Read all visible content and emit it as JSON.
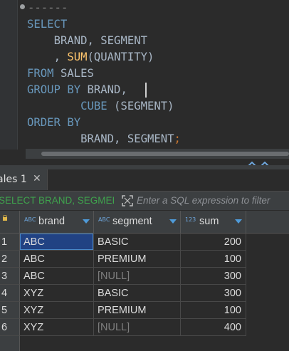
{
  "editor": {
    "comment": "------",
    "lines": [
      {
        "kw": "SELECT"
      },
      {
        "indent": "    ",
        "id": "BRAND, SEGMENT"
      },
      {
        "indent": "    ",
        "pre": ", ",
        "fn": "SUM",
        "post": "(QUANTITY)"
      },
      {
        "kw": "FROM",
        "post": " SALES"
      },
      {
        "kw": "GROUP BY",
        "post": " BRAND,"
      },
      {
        "indent": "        ",
        "kw": "CUBE",
        "post": " (SEGMENT)"
      },
      {
        "kw": "ORDER BY"
      },
      {
        "indent": "        ",
        "id": "BRAND, SEGMENT",
        "semi": ";"
      }
    ],
    "colors": {
      "keyword": "#6897bb",
      "function": "#ffc66d",
      "identifier": "#a9b7c6",
      "semicolon": "#cc7832"
    }
  },
  "results_tab": {
    "label": "ales 1",
    "close_icon": "close-icon"
  },
  "filter": {
    "query_text": "SELECT BRAND, SEGMEI",
    "expand_icon": "expand-icon",
    "placeholder": "Enter a SQL expression to filter"
  },
  "grid": {
    "columns": [
      {
        "type": "ABC",
        "label": "brand"
      },
      {
        "type": "ABC",
        "label": "segment"
      },
      {
        "type": "123",
        "label": "sum"
      }
    ],
    "rows": [
      {
        "num": "1",
        "brand": "ABC",
        "segment": "BASIC",
        "sum": "200",
        "segment_null": false
      },
      {
        "num": "2",
        "brand": "ABC",
        "segment": "PREMIUM",
        "sum": "100",
        "segment_null": false
      },
      {
        "num": "3",
        "brand": "ABC",
        "segment": "[NULL]",
        "sum": "300",
        "segment_null": true
      },
      {
        "num": "4",
        "brand": "XYZ",
        "segment": "BASIC",
        "sum": "300",
        "segment_null": false
      },
      {
        "num": "5",
        "brand": "XYZ",
        "segment": "PREMIUM",
        "sum": "100",
        "segment_null": false
      },
      {
        "num": "6",
        "brand": "XYZ",
        "segment": "[NULL]",
        "sum": "400",
        "segment_null": true
      }
    ],
    "selected_cell": {
      "row": 1,
      "column": "brand"
    },
    "colors": {
      "selection": "#214283",
      "null_text": "#7f7f7f",
      "type_badge": "#6ea6dc",
      "sort_arrow": "#4f9bd9"
    }
  }
}
